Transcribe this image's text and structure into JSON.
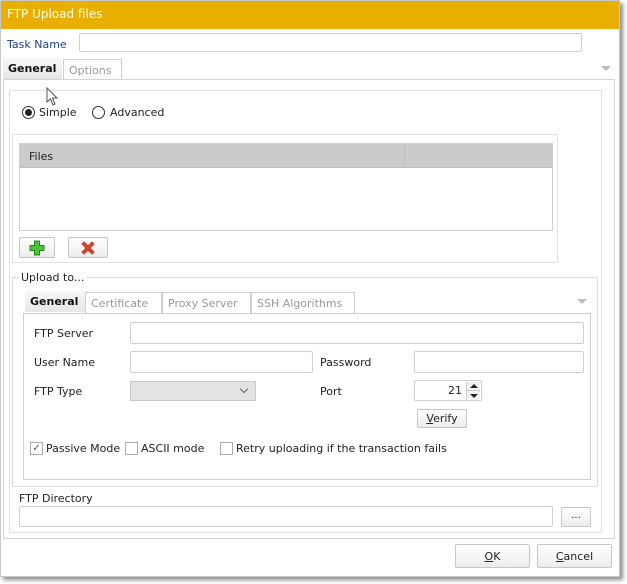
{
  "window": {
    "title": "FTP Upload files"
  },
  "task_name": {
    "label": "Task Name",
    "value": ""
  },
  "main_tabs": [
    {
      "label": "General",
      "active": true
    },
    {
      "label": "Options",
      "active": false
    }
  ],
  "mode": {
    "options": [
      {
        "label": "Simple",
        "checked": true
      },
      {
        "label": "Advanced",
        "checked": false
      }
    ]
  },
  "files_grid": {
    "columns": [
      "Files",
      ""
    ],
    "rows": []
  },
  "file_buttons": {
    "add_icon": "green-plus-icon",
    "remove_icon": "red-x-icon"
  },
  "upload_to": {
    "legend": "Upload to...",
    "tabs": [
      {
        "label": "General",
        "active": true
      },
      {
        "label": "Certificate",
        "active": false
      },
      {
        "label": "Proxy Server",
        "active": false
      },
      {
        "label": "SSH Algorithms",
        "active": false
      }
    ],
    "ftp_server": {
      "label": "FTP Server",
      "value": ""
    },
    "user_name": {
      "label": "User Name",
      "value": ""
    },
    "password": {
      "label": "Password",
      "value": ""
    },
    "ftp_type": {
      "label": "FTP Type",
      "value": ""
    },
    "port": {
      "label": "Port",
      "value": "21"
    },
    "verify_label": "Verify",
    "verify_accel": "V",
    "verify_rest": "erify",
    "checkboxes": [
      {
        "label": "Passive Mode",
        "checked": true
      },
      {
        "label": "ASCII mode",
        "checked": false
      },
      {
        "label": "Retry uploading if the transaction fails",
        "checked": false
      }
    ]
  },
  "ftp_directory": {
    "label": "FTP Directory",
    "value": "",
    "browse_label": "..."
  },
  "footer": {
    "ok_accel": "O",
    "ok_rest": "K",
    "cancel_accel": "C",
    "cancel_rest": "ancel"
  },
  "colors": {
    "titlebar": "#e8ae00",
    "task_label": "#1f3f8c"
  }
}
